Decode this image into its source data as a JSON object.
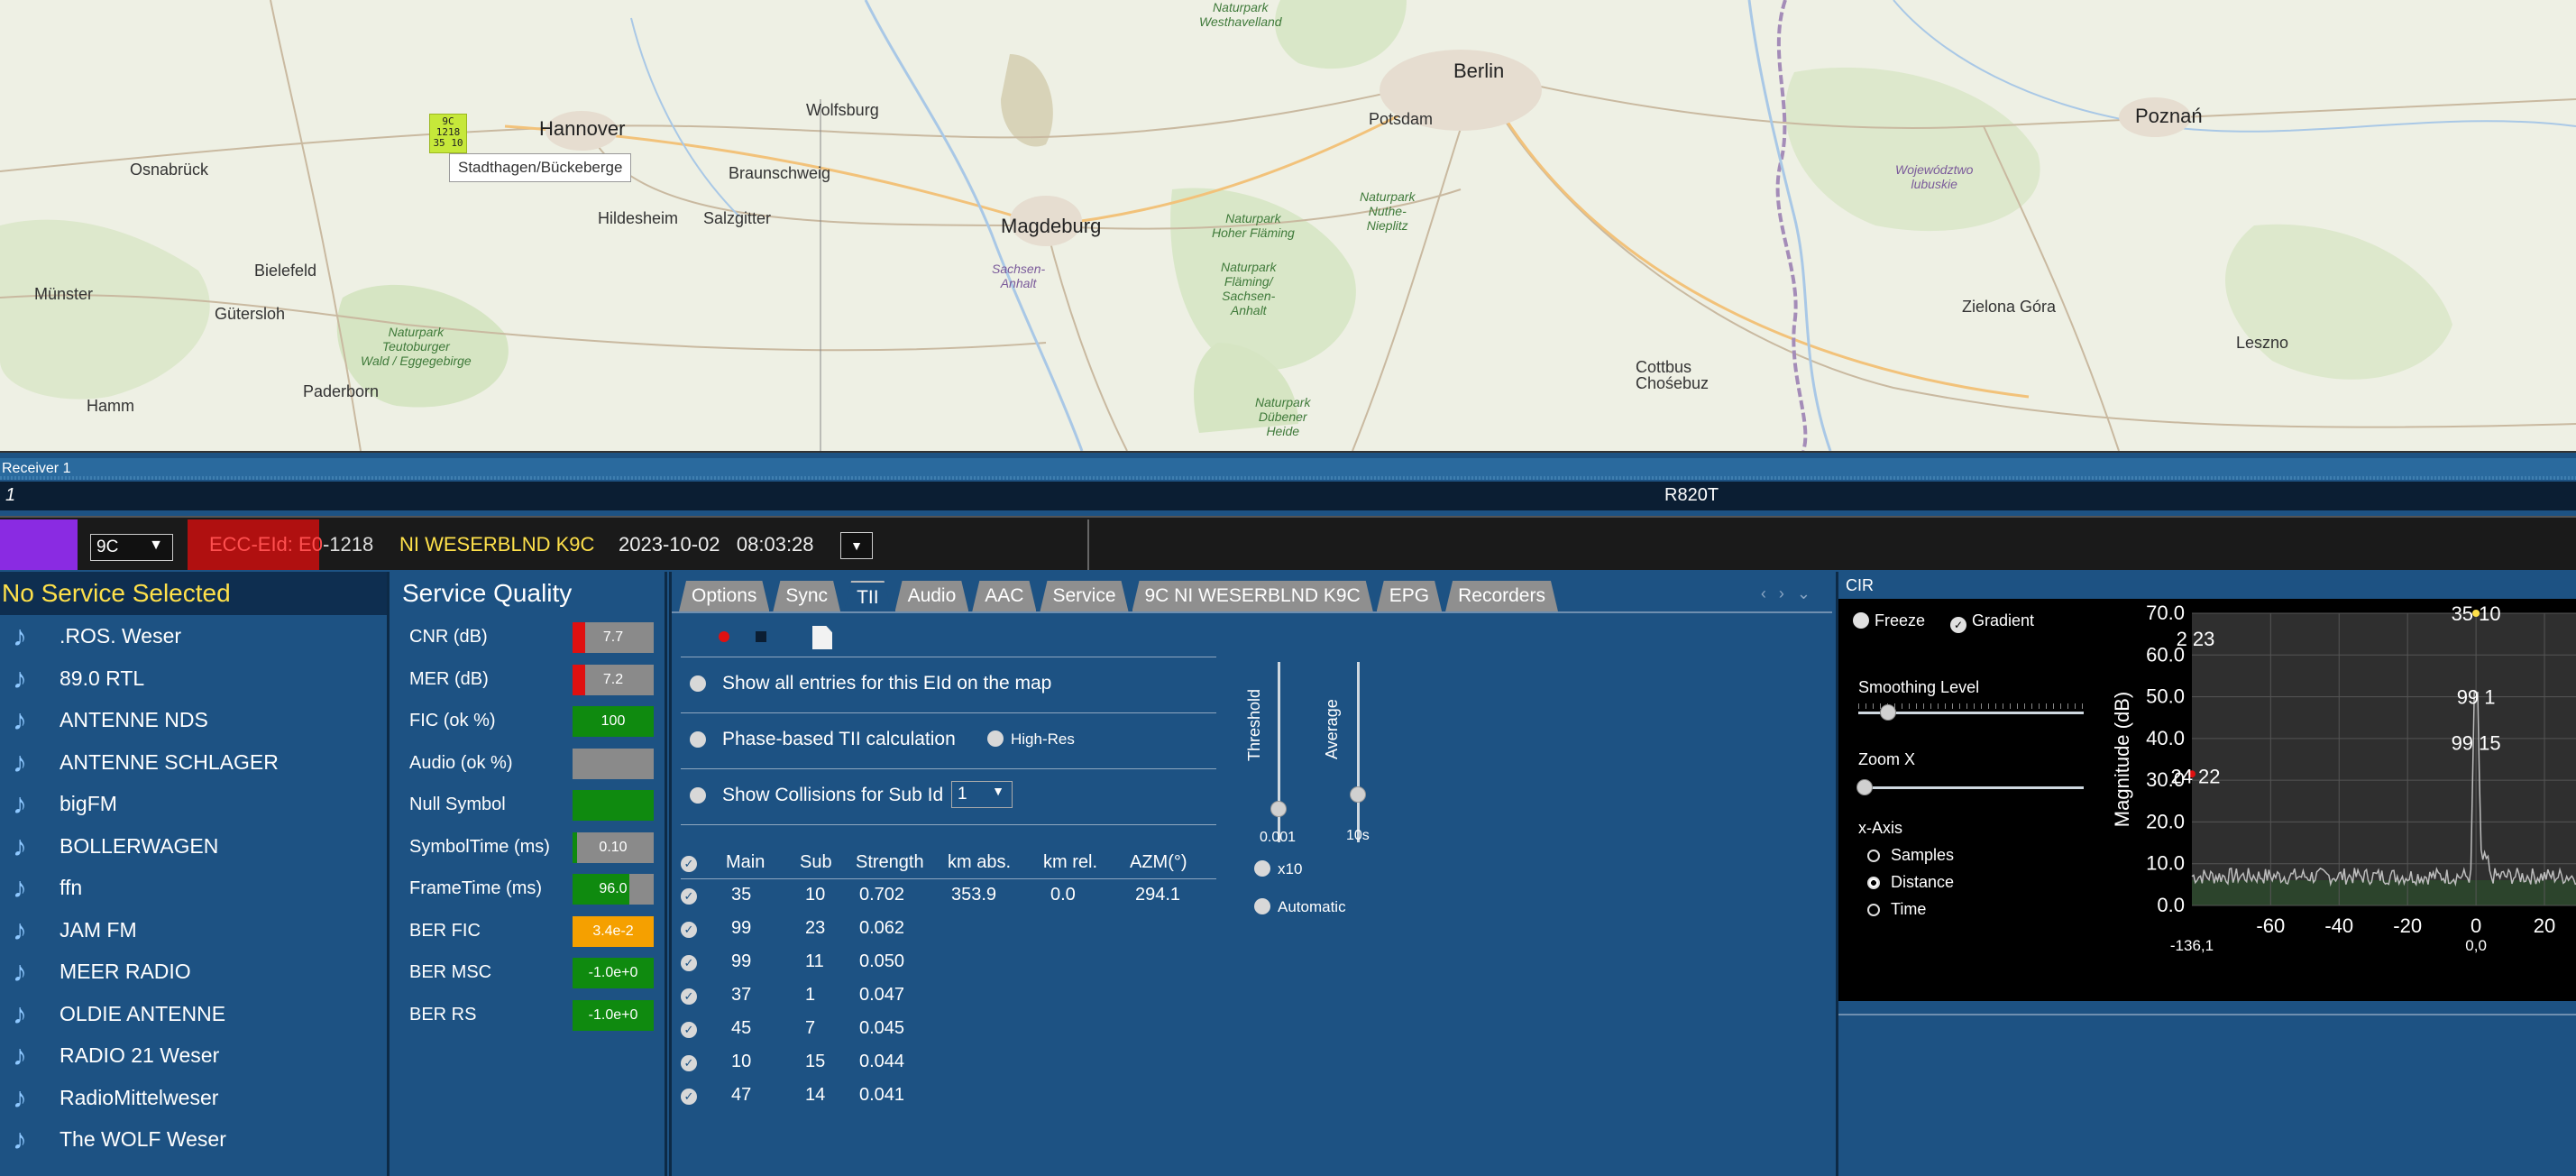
{
  "map": {
    "cities": [
      {
        "name": "Berlin",
        "big": true
      },
      {
        "name": "Hannover",
        "big": true
      },
      {
        "name": "Magdeburg",
        "big": true
      },
      {
        "name": "Poznań",
        "big": true
      },
      {
        "name": "Osnabrück"
      },
      {
        "name": "Wolfsburg"
      },
      {
        "name": "Braunschweig"
      },
      {
        "name": "Hildesheim"
      },
      {
        "name": "Salzgitter"
      },
      {
        "name": "Bielefeld"
      },
      {
        "name": "Gütersloh"
      },
      {
        "name": "Münster"
      },
      {
        "name": "Hamm"
      },
      {
        "name": "Paderborn"
      },
      {
        "name": "Potsdam"
      },
      {
        "name": "Cottbus\nChośebuz"
      },
      {
        "name": "Zielona Góra"
      },
      {
        "name": "Leszno"
      }
    ],
    "parks": [
      "Naturpark\nTeutoburger\nWald / Eggegebirge",
      "Naturpark\nHoher Fläming",
      "Naturpark\nNuthe-\nNieplitz",
      "Naturpark\nFläming/\nSachsen-\nAnhalt",
      "Naturpark\nDübener\nHeide",
      "Naturpark\nWesthavelland"
    ],
    "regions": [
      "Sachsen-\nAnhalt",
      "Województwo\nlubuskie"
    ],
    "transmitter": {
      "channel": "9C",
      "eid": "1218",
      "main": "35",
      "sub": "10",
      "tooltip": "Stadthagen/Bückeberge"
    }
  },
  "receiver": {
    "label": "Receiver 1",
    "index": "1",
    "tuner": "R820T"
  },
  "status": {
    "channel": "9C",
    "ecc_prefix": "ECC-EId: E0",
    "ecc_suffix": "-1218",
    "ensemble": "NI WESERBLND K9C",
    "date": "2023-10-02",
    "time": "08:03:28"
  },
  "services": {
    "header": "No Service Selected",
    "items": [
      ".ROS. Weser",
      "89.0 RTL",
      "ANTENNE NDS",
      "ANTENNE SCHLAGER",
      "bigFM",
      "BOLLERWAGEN",
      "ffn",
      "JAM FM",
      "MEER RADIO",
      "OLDIE ANTENNE",
      "RADIO 21 Weser",
      "RadioMittelweser",
      "The WOLF Weser"
    ]
  },
  "quality": {
    "header": "Service Quality",
    "rows": [
      {
        "label": "CNR (dB)",
        "value": "7.7",
        "fill": 0.15,
        "color": "#e01010"
      },
      {
        "label": "MER (dB)",
        "value": "7.2",
        "fill": 0.15,
        "color": "#e01010"
      },
      {
        "label": "FIC (ok %)",
        "value": "100",
        "fill": 1.0,
        "color": "#0f8a0f"
      },
      {
        "label": "Audio (ok %)",
        "value": "",
        "fill": 0.0,
        "color": "#0f8a0f"
      },
      {
        "label": "Null Symbol",
        "value": "",
        "fill": 1.0,
        "color": "#0f8a0f"
      },
      {
        "label": "SymbolTime (ms)",
        "value": "0.10",
        "fill": 0.05,
        "color": "#0f8a0f"
      },
      {
        "label": "FrameTime (ms)",
        "value": "96.0",
        "fill": 0.7,
        "color": "#0f8a0f"
      },
      {
        "label": "BER FIC",
        "value": "3.4e-2",
        "fill": 1.0,
        "color": "#f5a000"
      },
      {
        "label": "BER MSC",
        "value": "-1.0e+0",
        "fill": 1.0,
        "color": "#0f8a0f"
      },
      {
        "label": "BER RS",
        "value": "-1.0e+0",
        "fill": 1.0,
        "color": "#0f8a0f"
      }
    ]
  },
  "tii": {
    "tabs": [
      "Options",
      "Sync",
      "TII",
      "Audio",
      "AAC",
      "Service",
      "9C NI WESERBLND K9C",
      "EPG",
      "Recorders"
    ],
    "active_tab": "TII",
    "options": {
      "show_all": "Show all entries for this EId on the map",
      "phase_based": "Phase-based TII calculation",
      "high_res": "High-Res",
      "collisions": "Show Collisions for Sub Id",
      "sub_id": "1"
    },
    "columns": [
      "Main",
      "Sub",
      "Strength",
      "km abs.",
      "km rel.",
      "AZM(°)"
    ],
    "rows": [
      [
        "35",
        "10",
        "0.702",
        "353.9",
        "0.0",
        "294.1"
      ],
      [
        "99",
        "23",
        "0.062",
        "",
        "",
        ""
      ],
      [
        "99",
        "11",
        "0.050",
        "",
        "",
        ""
      ],
      [
        "37",
        "1",
        "0.047",
        "",
        "",
        ""
      ],
      [
        "45",
        "7",
        "0.045",
        "",
        "",
        ""
      ],
      [
        "10",
        "15",
        "0.044",
        "",
        "",
        ""
      ],
      [
        "47",
        "14",
        "0.041",
        "",
        "",
        ""
      ]
    ],
    "threshold": {
      "label": "Threshold",
      "value": "0.001"
    },
    "average": {
      "label": "Average",
      "value": "10s"
    },
    "x10": "x10",
    "automatic": "Automatic"
  },
  "cir": {
    "title": "CIR",
    "freeze": "Freeze",
    "gradient": "Gradient",
    "smoothing": "Smoothing Level",
    "zoom": "Zoom X",
    "xaxis": "x-Axis",
    "xaxis_options": [
      "Samples",
      "Distance",
      "Time"
    ],
    "xaxis_selected": "Distance",
    "ylabel": "Magnitude (dB)",
    "y_ticks": [
      "70.0",
      "60.0",
      "50.0",
      "40.0",
      "30.0",
      "20.0",
      "10.0",
      "0.0"
    ],
    "x_ticks": [
      "-60",
      "-40",
      "-20",
      "0",
      "20"
    ],
    "peak_labels": [
      "35 10",
      "2 23",
      "99 1",
      "99 15",
      "24 22"
    ],
    "x_min_label": "-136,1",
    "x_zero_label": "0,0"
  },
  "colors": {
    "panel": "#1d5283",
    "header_dark": "#0e2e50",
    "accent_yellow": "#ffe14a",
    "purple": "#8a2be2"
  }
}
